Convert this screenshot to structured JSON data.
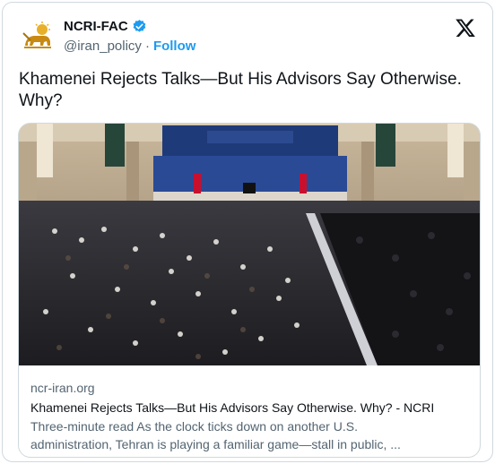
{
  "account": {
    "display_name": "NCRI-FAC",
    "handle": "@iran_policy",
    "separator": "·",
    "follow_label": "Follow",
    "avatar_icon": "lion-and-sun-emblem-icon",
    "verified_icon": "verified-badge-icon",
    "platform_icon": "x-logo-icon"
  },
  "tweet": {
    "text": "Khamenei Rejects Talks—But His Advisors Say Otherwise. Why?"
  },
  "link_card": {
    "image_description_icon": "assembly-hall-photo",
    "domain": "ncr-iran.org",
    "title": "Khamenei Rejects Talks—But His Advisors Say Otherwise. Why? - NCRI",
    "description_line1": "Three-minute read As the clock ticks down on another U.S.",
    "description_line2": "administration, Tehran is playing a familiar game—stall in public, ..."
  },
  "colors": {
    "accent": "#1d9bf0",
    "text_primary": "#0f1419",
    "text_secondary": "#536471",
    "border": "#cfd9de",
    "emblem": "#d4a017"
  }
}
